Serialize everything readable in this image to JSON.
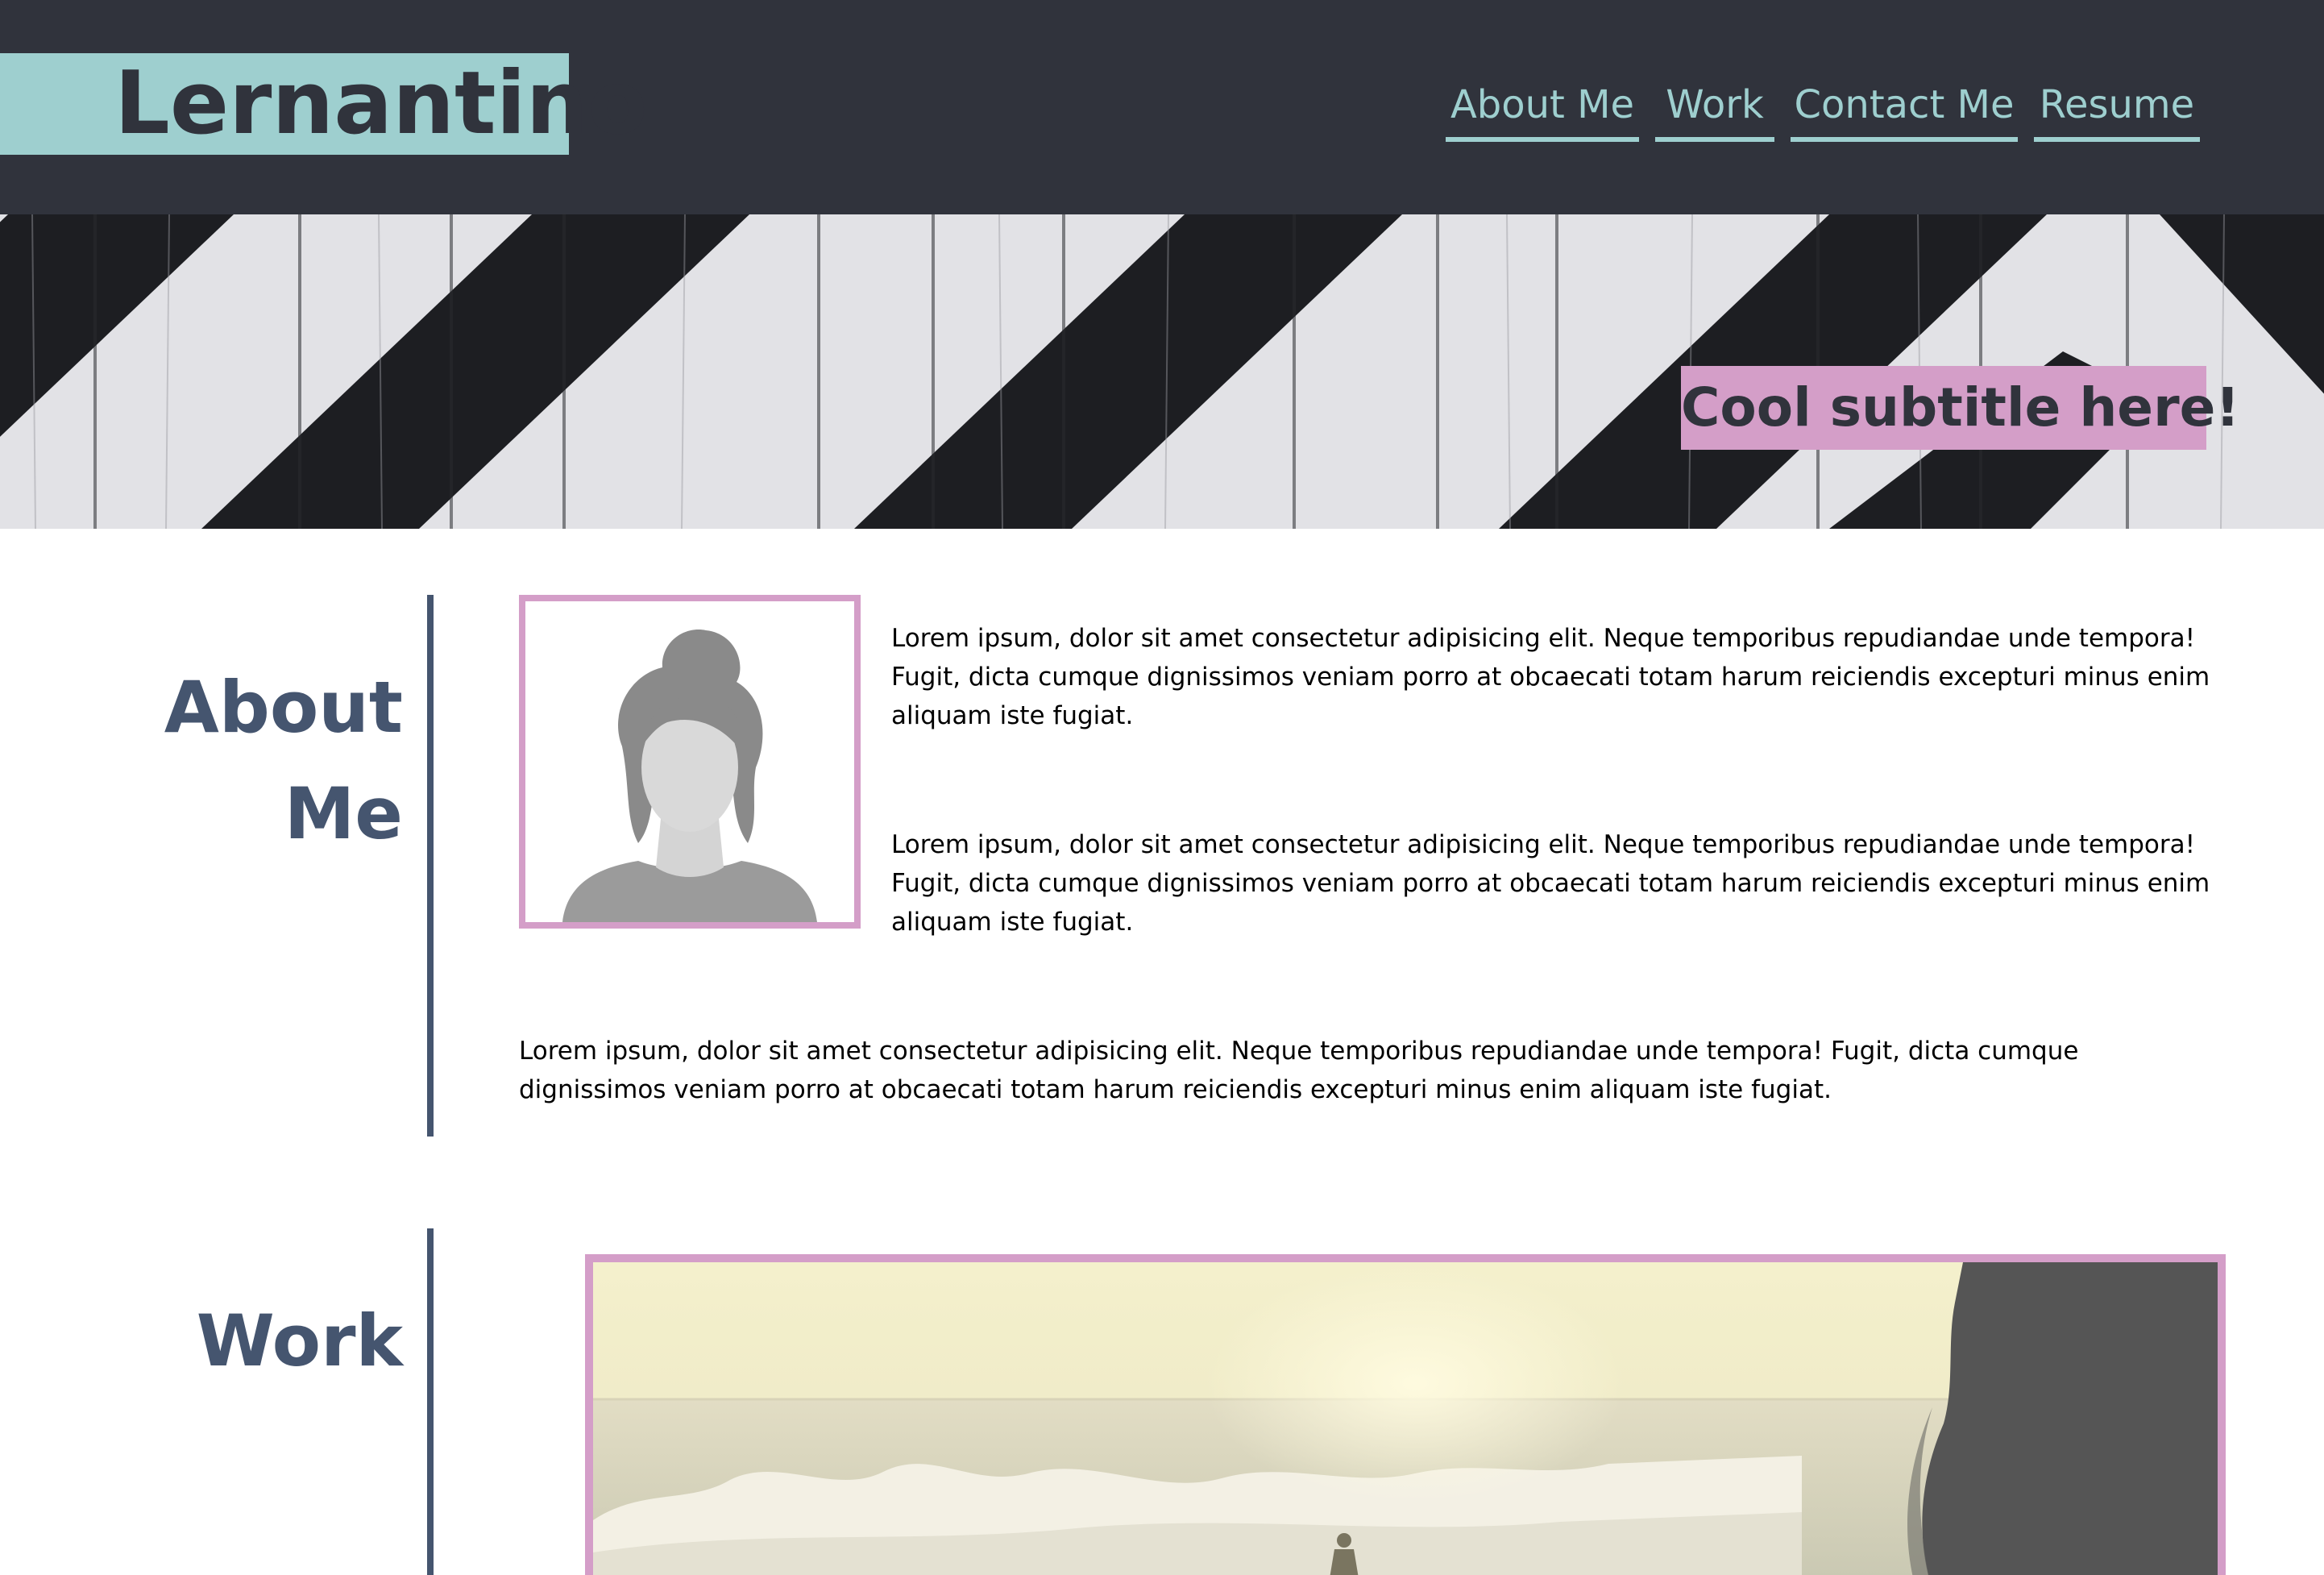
{
  "header": {
    "logo": "Lernantino",
    "nav": [
      {
        "label": "About Me"
      },
      {
        "label": "Work"
      },
      {
        "label": "Contact Me"
      },
      {
        "label": "Resume"
      }
    ]
  },
  "hero": {
    "subtitle": "Cool subtitle here!"
  },
  "about": {
    "title_line1": "About",
    "title_line2": "Me",
    "paragraphs": [
      "Lorem ipsum, dolor sit amet consectetur adipisicing elit. Neque temporibus repudiandae unde tempora! Fugit, dicta cumque dignissimos veniam porro at obcaecati totam harum reiciendis excepturi minus enim aliquam iste fugiat.",
      "Lorem ipsum, dolor sit amet consectetur adipisicing elit. Neque temporibus repudiandae unde tempora! Fugit, dicta cumque dignissimos veniam porro at obcaecati totam harum reiciendis excepturi minus enim aliquam iste fugiat.",
      "Lorem ipsum, dolor sit amet consectetur adipisicing elit. Neque temporibus repudiandae unde tempora! Fugit, dicta cumque dignissimos veniam porro at obcaecati totam harum reiciendis excepturi minus enim aliquam iste fugiat."
    ]
  },
  "work": {
    "title": "Work"
  },
  "colors": {
    "header_bg": "#30333c",
    "accent_teal": "#9ecfcf",
    "accent_pink": "#d49ec8",
    "section_title": "#45556f"
  }
}
